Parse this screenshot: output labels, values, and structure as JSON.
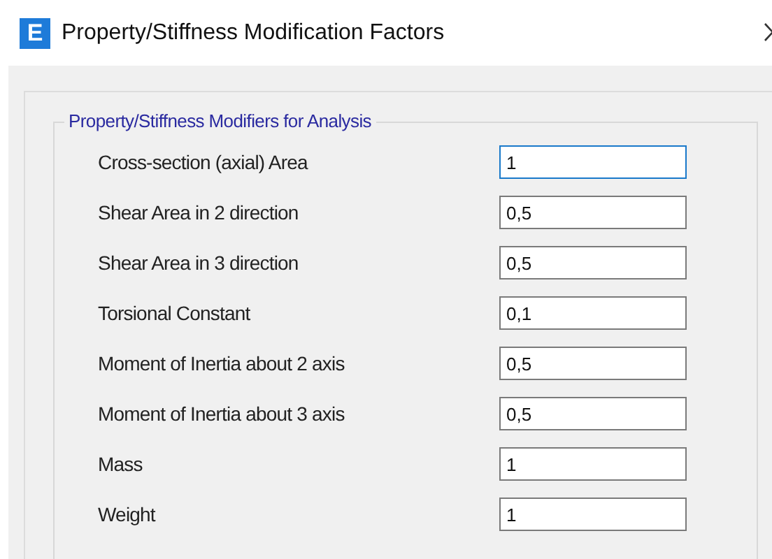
{
  "window": {
    "app_icon_letter": "E",
    "title": "Property/Stiffness Modification Factors"
  },
  "group": {
    "legend": "Property/Stiffness Modifiers for Analysis",
    "fields": [
      {
        "label": "Cross-section (axial) Area",
        "value": "1",
        "focused": true
      },
      {
        "label": "Shear Area in 2 direction",
        "value": "0,5",
        "focused": false
      },
      {
        "label": "Shear Area in 3 direction",
        "value": "0,5",
        "focused": false
      },
      {
        "label": "Torsional Constant",
        "value": "0,1",
        "focused": false
      },
      {
        "label": "Moment of Inertia about 2 axis",
        "value": "0,5",
        "focused": false
      },
      {
        "label": "Moment of Inertia about 3 axis",
        "value": "0,5",
        "focused": false
      },
      {
        "label": "Mass",
        "value": "1",
        "focused": false
      },
      {
        "label": "Weight",
        "value": "1",
        "focused": false
      }
    ]
  }
}
